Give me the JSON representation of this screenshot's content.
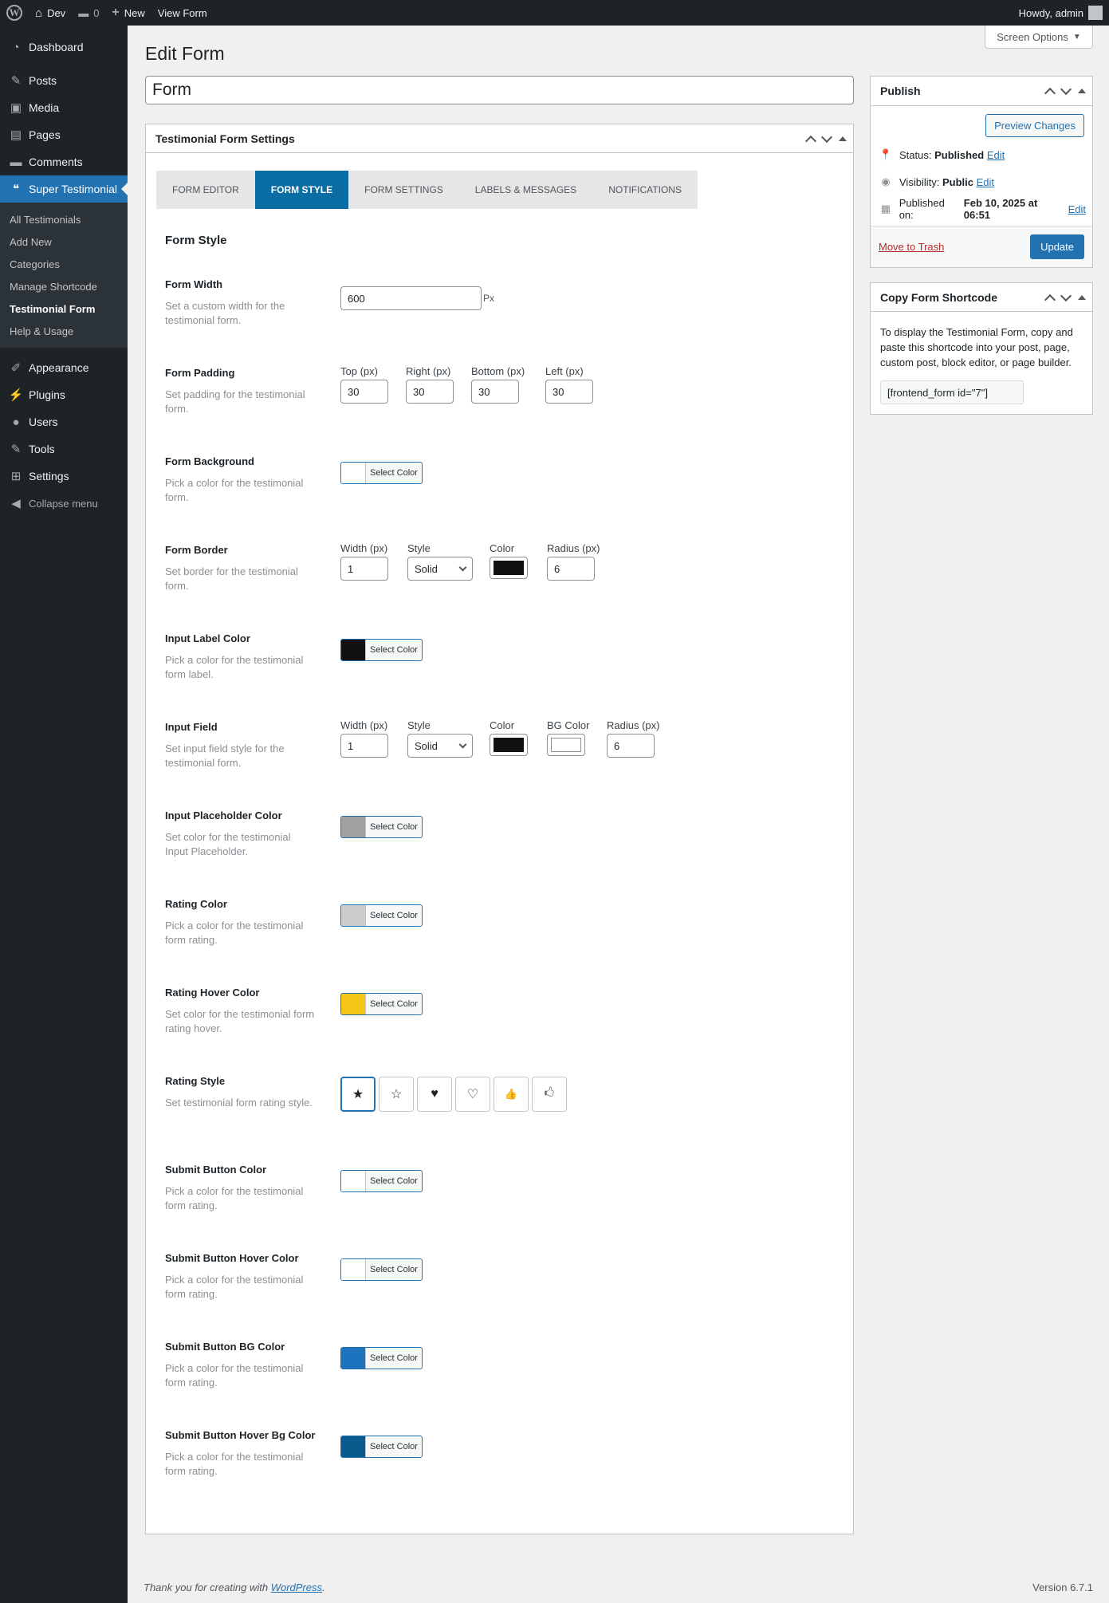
{
  "adminbar": {
    "site_name": "Dev",
    "comments_count": "0",
    "new_label": "New",
    "view_label": "View Form",
    "howdy": "Howdy, admin"
  },
  "sidebar": {
    "items_top": [
      {
        "label": "Dashboard",
        "icon": "dashboard-icon"
      },
      {
        "label": "Posts",
        "icon": "pin-icon"
      },
      {
        "label": "Media",
        "icon": "media-icon"
      },
      {
        "label": "Pages",
        "icon": "pages-icon"
      },
      {
        "label": "Comments",
        "icon": "comments-icon"
      }
    ],
    "active": {
      "label": "Super Testimonial",
      "icon": "testimonial-icon"
    },
    "submenu": [
      "All Testimonials",
      "Add New",
      "Categories",
      "Manage Shortcode",
      "Testimonial Form",
      "Help & Usage"
    ],
    "items_bottom": [
      {
        "label": "Appearance",
        "icon": "brush-icon"
      },
      {
        "label": "Plugins",
        "icon": "plugin-icon"
      },
      {
        "label": "Users",
        "icon": "users-icon"
      },
      {
        "label": "Tools",
        "icon": "wrench-icon"
      },
      {
        "label": "Settings",
        "icon": "settings-icon"
      }
    ],
    "collapse": "Collapse menu"
  },
  "header": {
    "title": "Edit Form",
    "screen_options": "Screen Options"
  },
  "post_title": "Form",
  "settings_box": {
    "title": "Testimonial Form Settings",
    "tabs": [
      "FORM EDITOR",
      "FORM STYLE",
      "FORM SETTINGS",
      "LABELS & MESSAGES",
      "NOTIFICATIONS"
    ],
    "active_tab": "FORM STYLE",
    "section_title": "Form Style",
    "select_color": "Select Color",
    "form_width": {
      "label": "Form Width",
      "desc": "Set a custom width for the testimonial form.",
      "value": "600",
      "unit": "Px"
    },
    "form_padding": {
      "label": "Form Padding",
      "desc": "Set padding for the testimonial form.",
      "fields": [
        {
          "label": "Top (px)",
          "value": "30"
        },
        {
          "label": "Right (px)",
          "value": "30"
        },
        {
          "label": "Bottom (px)",
          "value": "30"
        },
        {
          "label": "Left (px)",
          "value": "30"
        }
      ]
    },
    "form_background": {
      "label": "Form Background",
      "desc": "Pick a color for the testimonial form.",
      "color": "#ffffff"
    },
    "form_border": {
      "label": "Form Border",
      "desc": "Set border for the testimonial form.",
      "width_label": "Width (px)",
      "width": "1",
      "style_label": "Style",
      "style": "Solid",
      "color_label": "Color",
      "color": "#111111",
      "radius_label": "Radius (px)",
      "radius": "6"
    },
    "input_label_color": {
      "label": "Input Label Color",
      "desc": "Pick a color for the testimonial form label.",
      "color": "#111111"
    },
    "input_field": {
      "label": "Input Field",
      "desc": "Set input field style for the testimonial form.",
      "width_label": "Width (px)",
      "width": "1",
      "style_label": "Style",
      "style": "Solid",
      "color_label": "Color",
      "color": "#111111",
      "bg_label": "BG Color",
      "bg_color": "#ffffff",
      "radius_label": "Radius (px)",
      "radius": "6"
    },
    "placeholder_color": {
      "label": "Input Placeholder Color",
      "desc": "Set color for the testimonial Input Placeholder.",
      "color": "#a0a0a0"
    },
    "rating_color": {
      "label": "Rating Color",
      "desc": "Pick a color for the testimonial form rating.",
      "color": "#cccccc"
    },
    "rating_hover_color": {
      "label": "Rating Hover Color",
      "desc": "Set color for the testimonial form rating hover.",
      "color": "#f5c518"
    },
    "rating_style": {
      "label": "Rating Style",
      "desc": "Set testimonial form rating style.",
      "options": [
        {
          "icon": "star-filled-icon",
          "glyph": "★"
        },
        {
          "icon": "star-outline-icon",
          "glyph": "☆"
        },
        {
          "icon": "heart-filled-icon",
          "glyph": "♥"
        },
        {
          "icon": "heart-outline-icon",
          "glyph": "♡"
        },
        {
          "icon": "thumbs-up-filled-icon",
          "glyph": "👍"
        },
        {
          "icon": "thumbs-up-outline-icon",
          "glyph": "🖒"
        }
      ],
      "selected": 0
    },
    "submit_color": {
      "label": "Submit Button Color",
      "desc": "Pick a color for the testimonial form rating.",
      "color": "#ffffff"
    },
    "submit_hover_color": {
      "label": "Submit Button Hover Color",
      "desc": "Pick a color for the testimonial form rating.",
      "color": "#ffffff"
    },
    "submit_bg_color": {
      "label": "Submit Button BG Color",
      "desc": "Pick a color for the testimonial form rating.",
      "color": "#1e73be"
    },
    "submit_hover_bg_color": {
      "label": "Submit Button Hover Bg Color",
      "desc": "Pick a color for the testimonial form rating.",
      "color": "#0a5a8c"
    }
  },
  "publish": {
    "title": "Publish",
    "preview": "Preview Changes",
    "status_label": "Status:",
    "status_value": "Published",
    "visibility_label": "Visibility:",
    "visibility_value": "Public",
    "published_label": "Published on:",
    "published_value": "Feb 10, 2025 at 06:51",
    "edit": "Edit",
    "trash": "Move to Trash",
    "update": "Update"
  },
  "shortcode_box": {
    "title": "Copy Form Shortcode",
    "text": "To display the Testimonial Form, copy and paste this shortcode into your post, page, custom post, block editor, or page builder.",
    "shortcode": "[frontend_form id=\"7\"]"
  },
  "footer": {
    "thanks": "Thank you for creating with",
    "wordpress": "WordPress",
    "version": "Version 6.7.1"
  }
}
